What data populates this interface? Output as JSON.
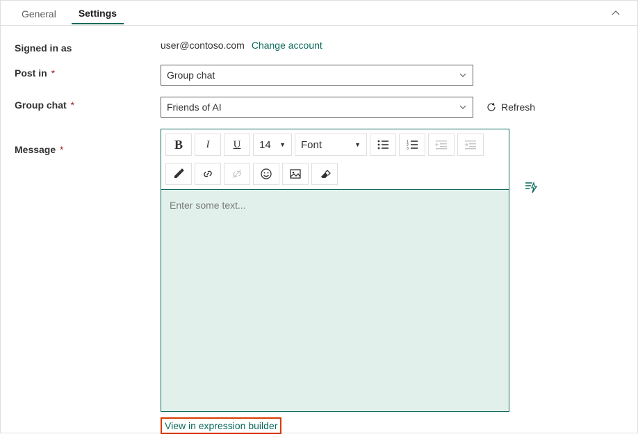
{
  "tabs": {
    "general": "General",
    "settings": "Settings"
  },
  "signed_in": {
    "label": "Signed in as",
    "value": "user@contoso.com",
    "change_link": "Change account"
  },
  "post_in": {
    "label": "Post in",
    "value": "Group chat"
  },
  "group_chat": {
    "label": "Group chat",
    "value": "Friends of AI",
    "refresh": "Refresh"
  },
  "message": {
    "label": "Message",
    "placeholder": "Enter some text...",
    "expr_link": "View in expression builder"
  },
  "toolbar": {
    "font_size": "14",
    "font_family": "Font"
  },
  "required_mark": "*"
}
